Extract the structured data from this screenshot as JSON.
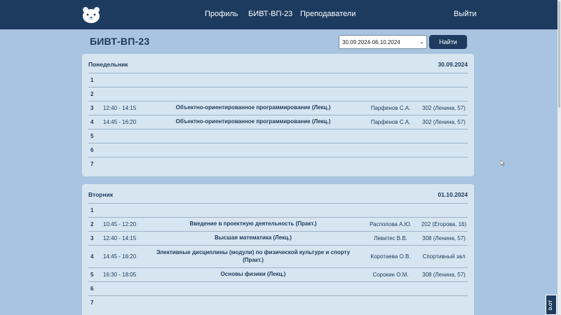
{
  "nav": {
    "profile": "Профиль",
    "group": "БИВТ-ВП-23",
    "teachers": "Преподаватели",
    "logout": "Выйти"
  },
  "page": {
    "title": "БИВТ-ВП-23"
  },
  "week_select": {
    "value": "30.09.2024-06.10.2024"
  },
  "find_button": "Найти",
  "days": [
    {
      "name": "Понедельник",
      "date": "30.09.2024",
      "rows": [
        {
          "num": "1",
          "time": "",
          "subject": "",
          "teacher": "",
          "room": ""
        },
        {
          "num": "2",
          "time": "",
          "subject": "",
          "teacher": "",
          "room": ""
        },
        {
          "num": "3",
          "time": "12:40 - 14:15",
          "subject": "Объектно-ориентированное программирование  (Лекц.)",
          "teacher": "Парфенов С.А.",
          "room": "302 (Ленина, 57)"
        },
        {
          "num": "4",
          "time": "14:45 - 16:20",
          "subject": "Объектно-ориентированное программирование  (Лекц.)",
          "teacher": "Парфенов С.А.",
          "room": "302 (Ленина, 57)"
        },
        {
          "num": "5",
          "time": "",
          "subject": "",
          "teacher": "",
          "room": ""
        },
        {
          "num": "6",
          "time": "",
          "subject": "",
          "teacher": "",
          "room": ""
        },
        {
          "num": "7",
          "time": "",
          "subject": "",
          "teacher": "",
          "room": ""
        }
      ]
    },
    {
      "name": "Вторник",
      "date": "01.10.2024",
      "rows": [
        {
          "num": "1",
          "time": "",
          "subject": "",
          "teacher": "",
          "room": ""
        },
        {
          "num": "2",
          "time": "10:45 - 12:20",
          "subject": "Введение в проектную деятельность  (Практ.)",
          "teacher": "Распопова А.Ю.",
          "room": "202 (Егорова, 16)"
        },
        {
          "num": "3",
          "time": "12:40 - 14:15",
          "subject": "Высшая математика  (Лекц.)",
          "teacher": "Левитес В.В.",
          "room": "308 (Ленина, 57)"
        },
        {
          "num": "4",
          "time": "14:45 - 16:20",
          "subject": "Элективные дисциплины (модули) по физической культуре и спорту (Практ.)",
          "teacher": "Коротаева О.В.",
          "room": "Спортивный зал"
        },
        {
          "num": "5",
          "time": "16:30 - 18:05",
          "subject": "Основы физики  (Лекц.)",
          "teacher": "Сорокин О.М.",
          "room": "308 (Ленина, 57)"
        },
        {
          "num": "6",
          "time": "",
          "subject": "",
          "teacher": "",
          "room": ""
        },
        {
          "num": "7",
          "time": "",
          "subject": "",
          "teacher": "",
          "room": ""
        }
      ]
    }
  ],
  "badge": "D.OT",
  "colors": {
    "navbar": "#1d3b5f",
    "background": "#a8c4e0",
    "card": "#d6e5f0",
    "text": "#1f3a5a"
  },
  "icons": {
    "logo": "bear-logo-icon",
    "select": "chevron-down-icon"
  }
}
